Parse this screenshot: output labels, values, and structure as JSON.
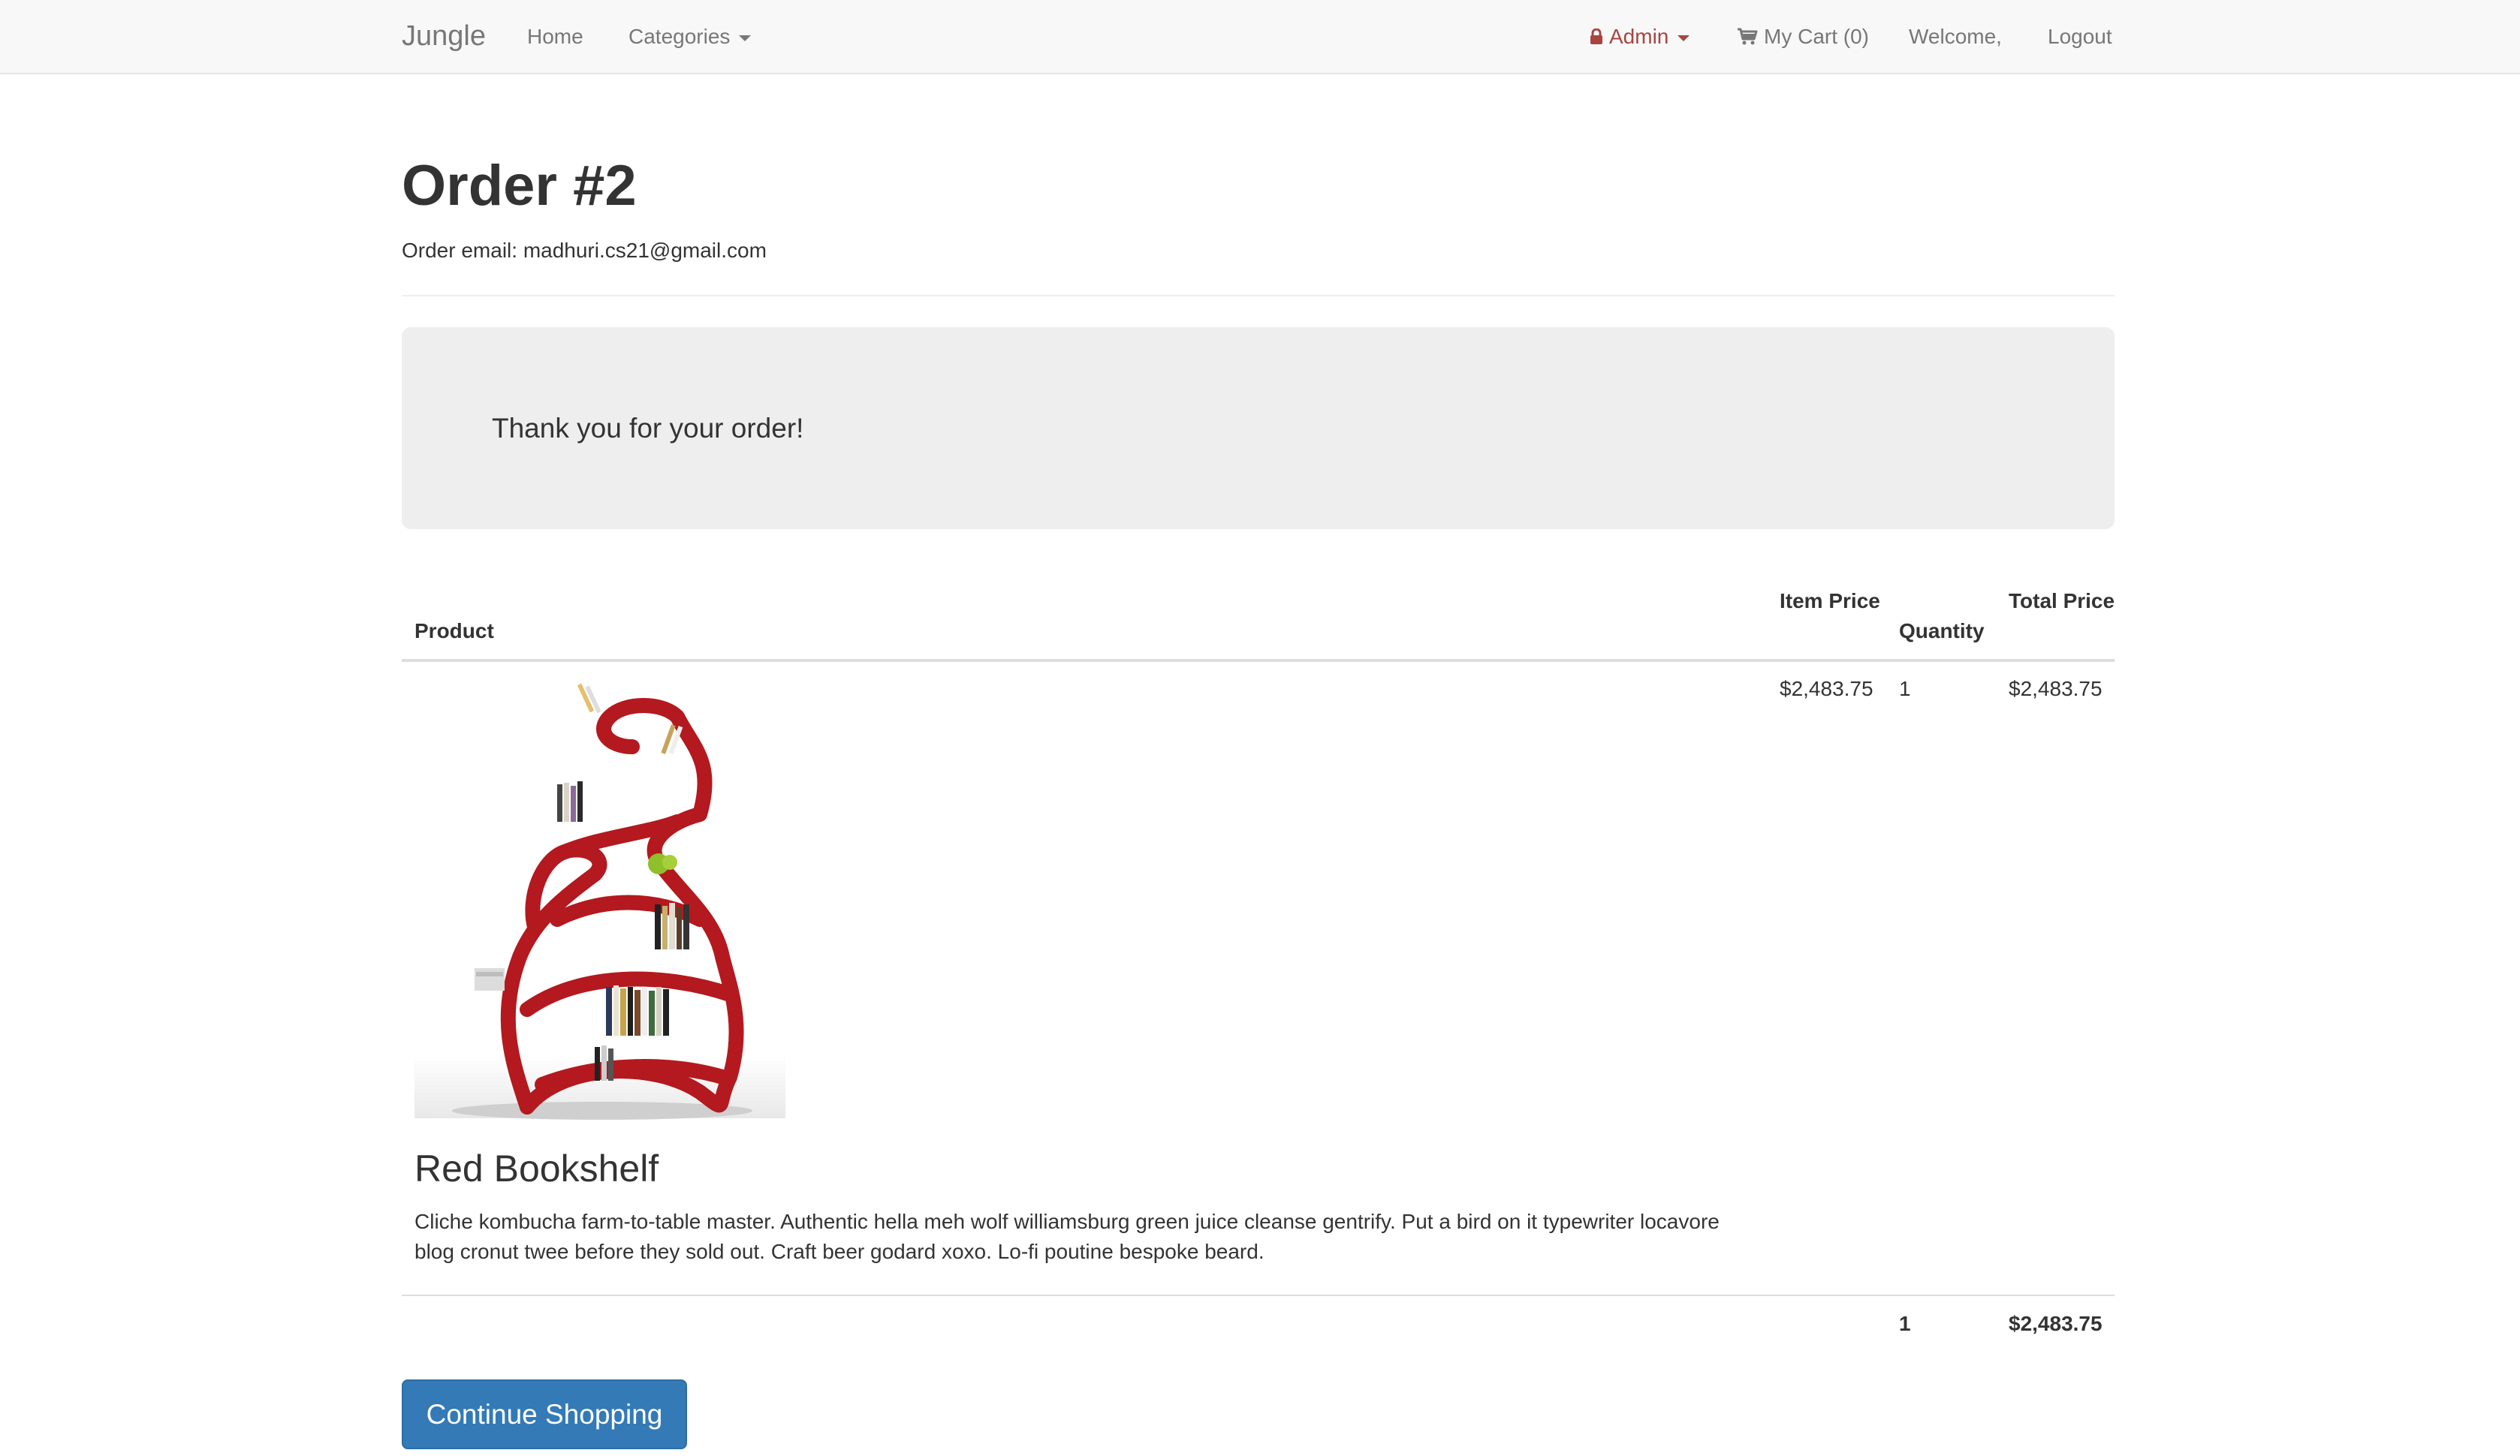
{
  "navbar": {
    "brand": "Jungle",
    "home": "Home",
    "categories": "Categories",
    "admin": "Admin",
    "cart": "My Cart (0)",
    "welcome": "Welcome,",
    "logout": "Logout",
    "icons": {
      "admin": "lock-icon",
      "cart": "shopping-cart-icon",
      "dropdown": "caret-down-icon"
    },
    "colors": {
      "admin": "#a94442",
      "link": "#777777",
      "background": "#f8f8f8"
    }
  },
  "order": {
    "title": "Order #2",
    "email_line": "Order email: madhuri.cs21@gmail.com"
  },
  "thanks": {
    "message": "Thank you for your order!"
  },
  "table": {
    "headers": {
      "product": "Product",
      "item_price": "Item Price",
      "quantity": "Quantity",
      "total_price": "Total Price"
    },
    "rows": [
      {
        "name": "Red Bookshelf",
        "description": "Cliche kombucha farm-to-table master. Authentic hella meh wolf williamsburg green juice cleanse gentrify. Put a bird on it typewriter locavore blog cronut twee before they sold out. Craft beer godard xoxo. Lo-fi poutine bespoke beard.",
        "item_price": "$2,483.75",
        "quantity": "1",
        "total_price": "$2,483.75",
        "image": "red-bookshelf"
      }
    ],
    "footer": {
      "quantity": "1",
      "total": "$2,483.75"
    }
  },
  "actions": {
    "continue_shopping": "Continue Shopping",
    "button_color": "#337ab7"
  }
}
